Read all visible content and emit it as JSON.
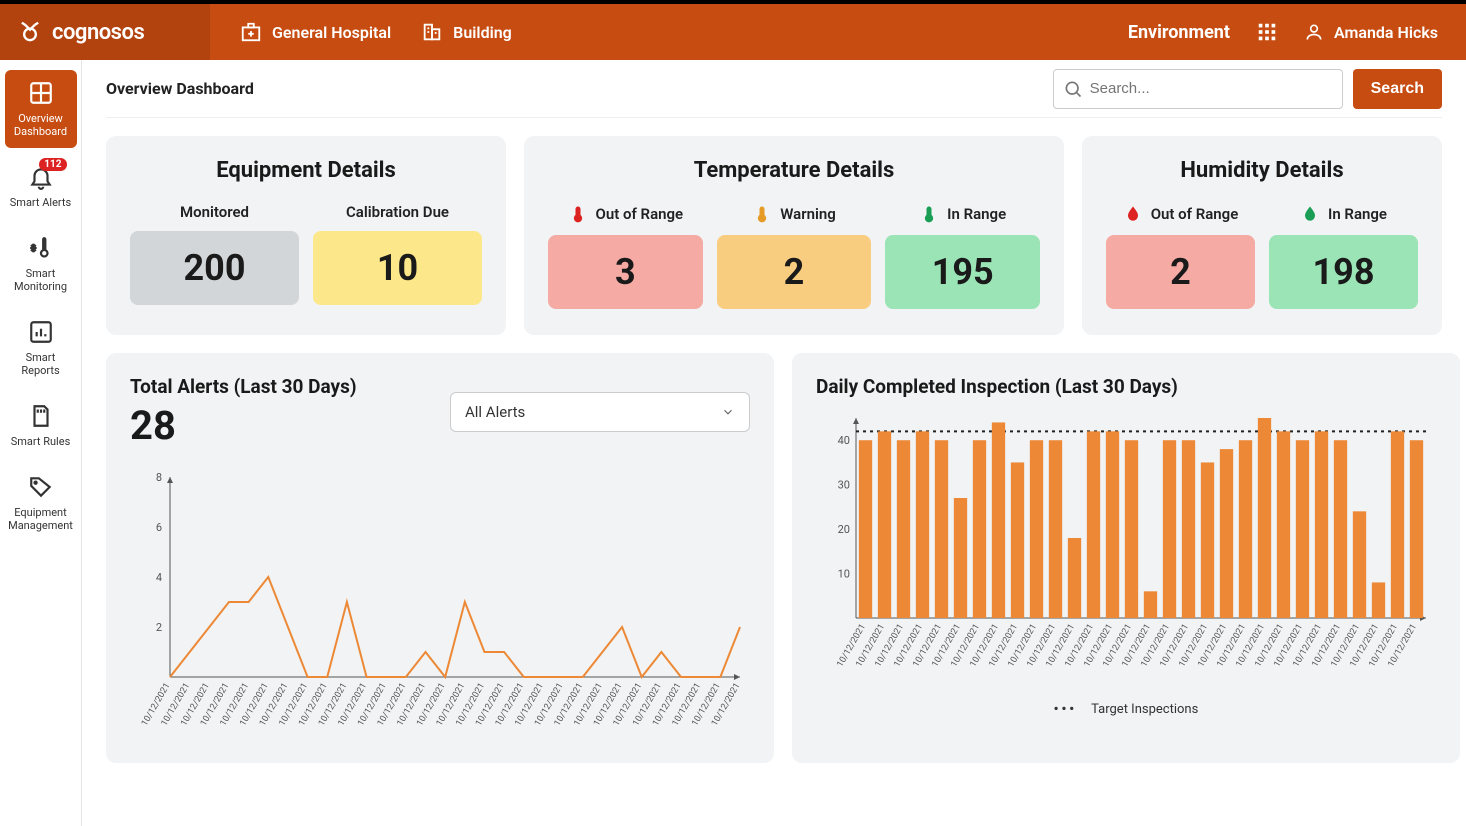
{
  "brand": "cognosos",
  "header": {
    "tab1": "General Hospital",
    "tab2": "Building",
    "env": "Environment",
    "user": "Amanda Hicks"
  },
  "sidebar": {
    "items": [
      {
        "label": "Overview Dashboard",
        "badge": ""
      },
      {
        "label": "Smart Alerts",
        "badge": "112"
      },
      {
        "label": "Smart Monitoring",
        "badge": ""
      },
      {
        "label": "Smart Reports",
        "badge": ""
      },
      {
        "label": "Smart Rules",
        "badge": ""
      },
      {
        "label": "Equipment Management",
        "badge": ""
      }
    ]
  },
  "page": {
    "title": "Overview Dashboard",
    "search_placeholder": "Search...",
    "search_btn": "Search"
  },
  "cards": {
    "equipment": {
      "title": "Equipment Details",
      "monitored_label": "Monitored",
      "monitored_value": "200",
      "calib_label": "Calibration Due",
      "calib_value": "10"
    },
    "temperature": {
      "title": "Temperature Details",
      "out_label": "Out of Range",
      "out_value": "3",
      "warn_label": "Warning",
      "warn_value": "2",
      "in_label": "In Range",
      "in_value": "195"
    },
    "humidity": {
      "title": "Humidity Details",
      "out_label": "Out of Range",
      "out_value": "2",
      "in_label": "In Range",
      "in_value": "198"
    }
  },
  "alerts_chart": {
    "title": "Total Alerts (Last 30 Days)",
    "total": "28",
    "dropdown": "All Alerts"
  },
  "inspection_chart": {
    "title": "Daily Completed Inspection (Last 30 Days)",
    "legend": "Target Inspections"
  },
  "chart_data": [
    {
      "type": "line",
      "title": "Total Alerts (Last 30 Days)",
      "xlabel": "",
      "ylabel": "",
      "ylim": [
        0,
        8
      ],
      "x": [
        "10/12/2021",
        "10/12/2021",
        "10/12/2021",
        "10/12/2021",
        "10/12/2021",
        "10/12/2021",
        "10/12/2021",
        "10/12/2021",
        "10/12/2021",
        "10/12/2021",
        "10/12/2021",
        "10/12/2021",
        "10/12/2021",
        "10/12/2021",
        "10/12/2021",
        "10/12/2021",
        "10/12/2021",
        "10/12/2021",
        "10/12/2021",
        "10/12/2021",
        "10/12/2021",
        "10/12/2021",
        "10/12/2021",
        "10/12/2021",
        "10/12/2021",
        "10/12/2021",
        "10/12/2021",
        "10/12/2021",
        "10/12/2021",
        "10/12/2021"
      ],
      "y": [
        0,
        1,
        2,
        3,
        3,
        4,
        2,
        0,
        0,
        3,
        0,
        0,
        0,
        1,
        0,
        3,
        1,
        1,
        0,
        0,
        0,
        0,
        1,
        2,
        0,
        1,
        0,
        0,
        0,
        2
      ]
    },
    {
      "type": "bar",
      "title": "Daily Completed Inspection (Last 30 Days)",
      "xlabel": "",
      "ylabel": "",
      "ylim": [
        0,
        45
      ],
      "target": 42,
      "categories": [
        "10/12/2021",
        "10/12/2021",
        "10/12/2021",
        "10/12/2021",
        "10/12/2021",
        "10/12/2021",
        "10/12/2021",
        "10/12/2021",
        "10/12/2021",
        "10/12/2021",
        "10/12/2021",
        "10/12/2021",
        "10/12/2021",
        "10/12/2021",
        "10/12/2021",
        "10/12/2021",
        "10/12/2021",
        "10/12/2021",
        "10/12/2021",
        "10/12/2021",
        "10/12/2021",
        "10/12/2021",
        "10/12/2021",
        "10/12/2021",
        "10/12/2021",
        "10/12/2021",
        "10/12/2021",
        "10/12/2021",
        "10/12/2021",
        "10/12/2021"
      ],
      "values": [
        40,
        42,
        40,
        42,
        40,
        27,
        40,
        44,
        35,
        40,
        40,
        18,
        42,
        42,
        40,
        6,
        40,
        40,
        35,
        38,
        40,
        45,
        42,
        40,
        42,
        40,
        24,
        8,
        42,
        40
      ]
    }
  ],
  "colors": {
    "brand": "#c64c11",
    "chart_orange": "#ed8936"
  }
}
